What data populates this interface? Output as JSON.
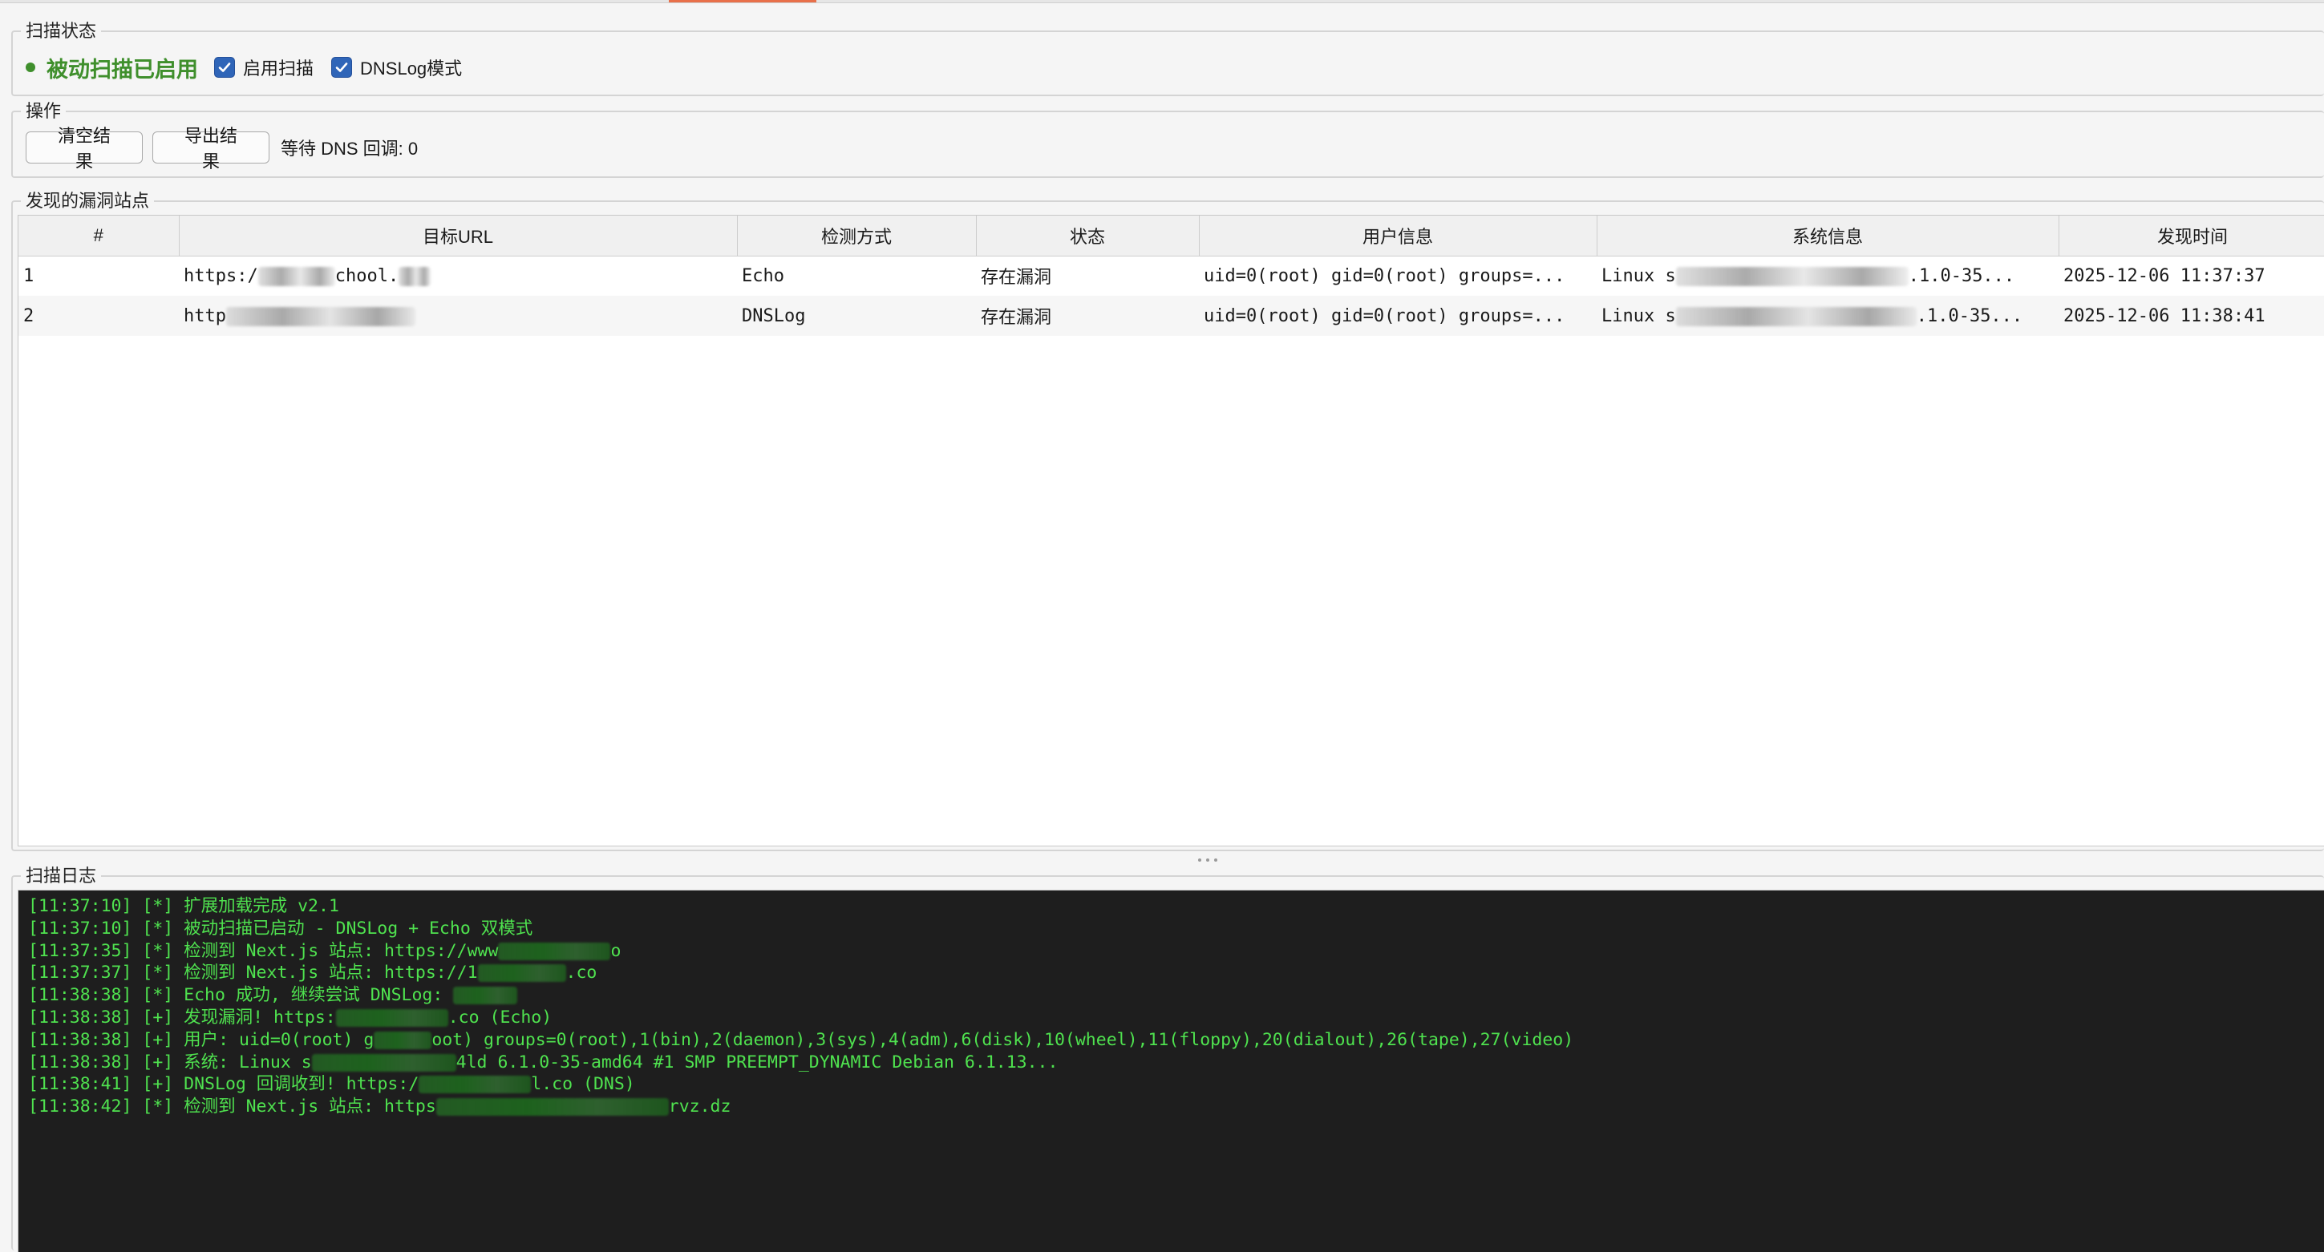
{
  "status_section": {
    "title": "扫描状态",
    "status_text": "被动扫描已启用",
    "status_color": "#3f8f2c",
    "enable_scan_label": "启用扫描",
    "enable_scan_checked": true,
    "dnslog_mode_label": "DNSLog模式",
    "dnslog_mode_checked": true
  },
  "ops_section": {
    "title": "操作",
    "clear_button": "清空结果",
    "export_button": "导出结果",
    "dns_wait_text": "等待 DNS 回调: 0"
  },
  "sites_section": {
    "title": "发现的漏洞站点",
    "columns": [
      "#",
      "目标URL",
      "检测方式",
      "状态",
      "用户信息",
      "系统信息",
      "发现时间"
    ],
    "rows": [
      {
        "index": "1",
        "url_prefix": "https:/",
        "url_suffix": "chool.",
        "method": "Echo",
        "status": "存在漏洞",
        "user_info": "uid=0(root) gid=0(root) groups=...",
        "sys_prefix": "Linux s",
        "sys_suffix": ".1.0-35...",
        "time": "2025-12-06 11:37:37"
      },
      {
        "index": "2",
        "url_prefix": "http",
        "url_suffix": "",
        "method": "DNSLog",
        "status": "存在漏洞",
        "user_info": "uid=0(root) gid=0(root) groups=...",
        "sys_prefix": "Linux s",
        "sys_suffix": ".1.0-35...",
        "time": "2025-12-06 11:38:41"
      }
    ]
  },
  "log_section": {
    "title": "扫描日志",
    "text_color": "#4fe24f",
    "background": "#1e1e1e",
    "lines": [
      {
        "a": "[11:37:10] [*] 扩展加载完成 v2.1",
        "b": ""
      },
      {
        "a": "[11:37:10] [*] 被动扫描已启动 - DNSLog + Echo 双模式",
        "b": ""
      },
      {
        "a": "[11:37:35] [*] 检测到 Next.js 站点: https://www",
        "b": "o"
      },
      {
        "a": "[11:37:37] [*] 检测到 Next.js 站点: https://1",
        "b": ".co"
      },
      {
        "a": "[11:38:38] [*] Echo 成功, 继续尝试 DNSLog: ",
        "b": ""
      },
      {
        "a": "[11:38:38] [+] 发现漏洞! https:",
        "b": ".co (Echo)"
      },
      {
        "a": "[11:38:38] [+] 用户: uid=0(root) g",
        "b": "oot) groups=0(root),1(bin),2(daemon),3(sys),4(adm),6(disk),10(wheel),11(floppy),20(dialout),26(tape),27(video)"
      },
      {
        "a": "[11:38:38] [+] 系统: Linux s",
        "b": "4ld 6.1.0-35-amd64 #1 SMP PREEMPT_DYNAMIC Debian 6.1.13..."
      },
      {
        "a": "[11:38:41] [+] DNSLog 回调收到! https:/",
        "b": "l.co (DNS)"
      },
      {
        "a": "[11:38:42] [*] 检测到 Next.js 站点: https",
        "b": "rvz.dz"
      }
    ]
  }
}
